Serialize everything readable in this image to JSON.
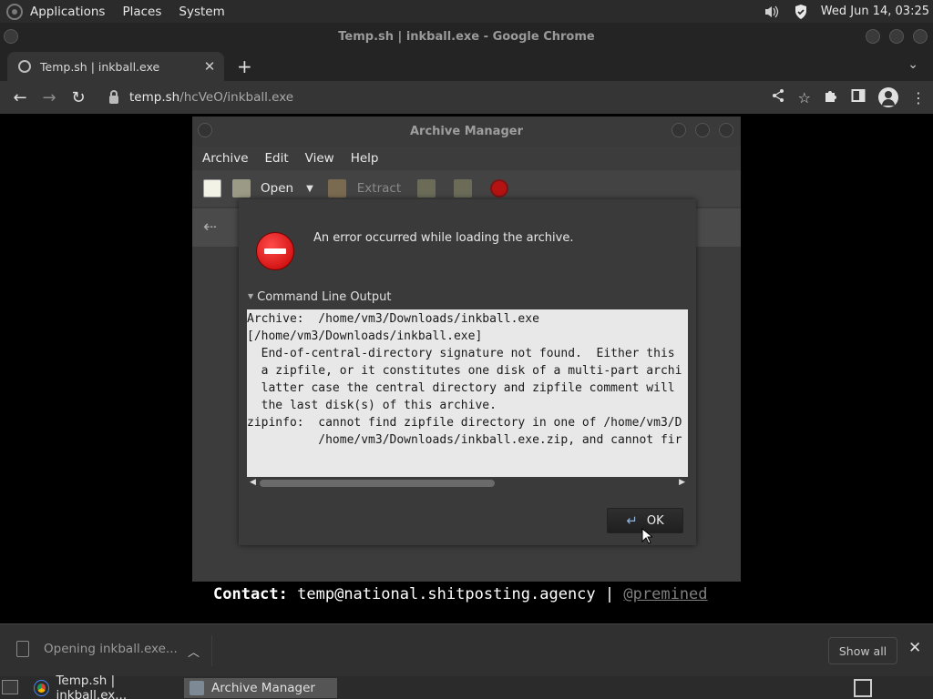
{
  "top_panel": {
    "menus": [
      "Applications",
      "Places",
      "System"
    ],
    "clock": "Wed Jun 14, 03:25",
    "tray_icons": [
      "volume-icon",
      "shield-icon"
    ]
  },
  "browser": {
    "window_title": "Temp.sh | inkball.exe - Google Chrome",
    "tab_title": "Temp.sh | inkball.exe",
    "url_host": "temp.sh",
    "url_path": "/hcVeO/inkball.exe"
  },
  "page": {
    "contact_label": "Contact:",
    "contact_email": "temp@national.shitposting.agency",
    "separator": "|",
    "contact_handle": "@premined"
  },
  "archive_manager": {
    "title": "Archive Manager",
    "menus": [
      "Archive",
      "Edit",
      "View",
      "Help"
    ],
    "toolbar": {
      "open_label": "Open",
      "extract_label": "Extract"
    }
  },
  "error_dialog": {
    "message": "An error occurred while loading the archive.",
    "expander_label": "Command Line Output",
    "output_lines": [
      "Archive:  /home/vm3/Downloads/inkball.exe",
      "[/home/vm3/Downloads/inkball.exe]",
      "  End-of-central-directory signature not found.  Either this",
      "  a zipfile, or it constitutes one disk of a multi-part archi",
      "  latter case the central directory and zipfile comment will",
      "  the last disk(s) of this archive.",
      "zipinfo:  cannot find zipfile directory in one of /home/vm3/D",
      "          /home/vm3/Downloads/inkball.exe.zip, and cannot fir"
    ],
    "ok_label": "OK"
  },
  "download_shelf": {
    "item_label": "Opening inkball.exe...",
    "show_all_label": "Show all"
  },
  "taskbar": {
    "tasks": [
      "Temp.sh | inkball.ex...",
      "Archive Manager"
    ]
  },
  "colors": {
    "panel_bg": "#2b2b2b",
    "dialog_bg": "#3a3a3a",
    "output_bg": "#e8e8e8",
    "error_red": "#d11010"
  }
}
